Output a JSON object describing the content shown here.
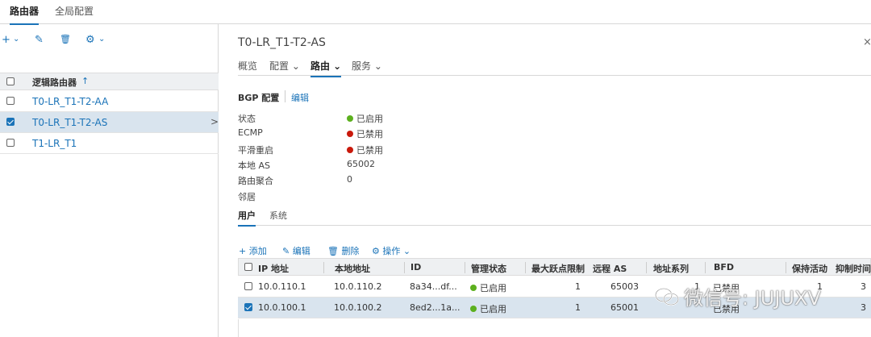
{
  "top_tabs": [
    "路由器",
    "全局配置"
  ],
  "left_panel": {
    "toolbar": {
      "add": "+",
      "add_caret": "⌄",
      "edit": "✎",
      "delete": "🗑",
      "gear": "⚙",
      "gear_caret": "⌄"
    },
    "header": "逻辑路由器",
    "sort_arrow": "↑",
    "rows": [
      {
        "name": "T0-LR_T1-T2-AA",
        "checked": false,
        "selected": false
      },
      {
        "name": "T0-LR_T1-T2-AS",
        "checked": true,
        "selected": true
      },
      {
        "name": "T1-LR_T1",
        "checked": false,
        "selected": false
      }
    ],
    "expand_arrow": ">"
  },
  "detail": {
    "title": "T0-LR_T1-T2-AS",
    "close": "×",
    "tabs": [
      {
        "label": "概览"
      },
      {
        "label": "配置 ⌄"
      },
      {
        "label": "路由 ⌄"
      },
      {
        "label": "服务 ⌄"
      }
    ],
    "bgp_heading": "BGP 配置",
    "edit_link": "编辑",
    "props": [
      {
        "label": "状态",
        "value": "已启用",
        "status": "green"
      },
      {
        "label": "ECMP",
        "value": "已禁用",
        "status": "red"
      },
      {
        "label": "平滑重启",
        "value": "已禁用",
        "status": "red"
      },
      {
        "label": "本地 AS",
        "value": "65002",
        "status": ""
      },
      {
        "label": "路由聚合",
        "value": "0",
        "status": ""
      }
    ],
    "neighbors_label": "邻居",
    "subtabs": [
      "用户",
      "系统"
    ],
    "table_toolbar": {
      "add": "+ 添加",
      "edit": "✎ 编辑",
      "delete": "🗑 删除",
      "actions": "⚙ 操作 ⌄"
    },
    "columns": [
      "IP 地址",
      "本地地址",
      "ID",
      "管理状态",
      "最大跃点限制",
      "远程 AS",
      "地址系列",
      "BFD",
      "保持活动",
      "抑制时间"
    ],
    "rows": [
      {
        "ip": "10.0.110.1",
        "local": "10.0.110.2",
        "id": "8a34...df...",
        "admin": "已启用",
        "hops": "1",
        "remote_as": "65003",
        "family": "1",
        "bfd": "已禁用",
        "keepalive": "1",
        "hold": "3",
        "checked": false,
        "selected": false
      },
      {
        "ip": "10.0.100.1",
        "local": "10.0.100.2",
        "id": "8ed2...1a...",
        "admin": "已启用",
        "hops": "1",
        "remote_as": "65001",
        "family": "",
        "bfd": "已禁用",
        "keepalive": "",
        "hold": "3",
        "checked": true,
        "selected": true
      }
    ]
  },
  "watermark": "微信号: JUJUXV",
  "colors": {
    "accent": "#1a73b8",
    "enabled": "#5cb01e",
    "disabled": "#c9190b",
    "selected_row": "#d9e4ee"
  }
}
